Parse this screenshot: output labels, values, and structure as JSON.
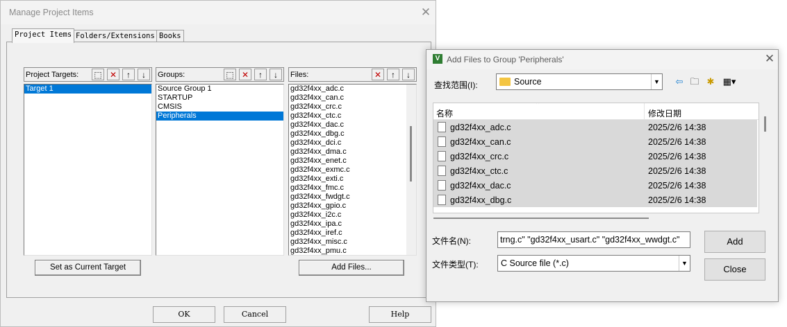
{
  "manage": {
    "title": "Manage Project Items",
    "tabs": [
      "Project Items",
      "Folders/Extensions",
      "Books"
    ],
    "targets_label": "Project Targets:",
    "groups_label": "Groups:",
    "files_label": "Files:",
    "targets": [
      "Target 1"
    ],
    "groups": [
      "Source Group 1",
      "STARTUP",
      "CMSIS",
      "Peripherals"
    ],
    "selected_group": "Peripherals",
    "files": [
      "gd32f4xx_adc.c",
      "gd32f4xx_can.c",
      "gd32f4xx_crc.c",
      "gd32f4xx_ctc.c",
      "gd32f4xx_dac.c",
      "gd32f4xx_dbg.c",
      "gd32f4xx_dci.c",
      "gd32f4xx_dma.c",
      "gd32f4xx_enet.c",
      "gd32f4xx_exmc.c",
      "gd32f4xx_exti.c",
      "gd32f4xx_fmc.c",
      "gd32f4xx_fwdgt.c",
      "gd32f4xx_gpio.c",
      "gd32f4xx_i2c.c",
      "gd32f4xx_ipa.c",
      "gd32f4xx_iref.c",
      "gd32f4xx_misc.c",
      "gd32f4xx_pmu.c"
    ],
    "set_current_label": "Set as Current Target",
    "add_files_label": "Add Files...",
    "ok_label": "OK",
    "cancel_label": "Cancel",
    "help_label": "Help"
  },
  "add_files": {
    "title": "Add Files to Group 'Peripherals'",
    "look_in_label": "查找范围(I):",
    "look_in_value": "Source",
    "col_name": "名称",
    "col_date": "修改日期",
    "rows": [
      {
        "name": "gd32f4xx_adc.c",
        "date": "2025/2/6 14:38"
      },
      {
        "name": "gd32f4xx_can.c",
        "date": "2025/2/6 14:38"
      },
      {
        "name": "gd32f4xx_crc.c",
        "date": "2025/2/6 14:38"
      },
      {
        "name": "gd32f4xx_ctc.c",
        "date": "2025/2/6 14:38"
      },
      {
        "name": "gd32f4xx_dac.c",
        "date": "2025/2/6 14:38"
      },
      {
        "name": "gd32f4xx_dbg.c",
        "date": "2025/2/6 14:38"
      }
    ],
    "filename_label": "文件名(N):",
    "filename_value": "trng.c\" \"gd32f4xx_usart.c\" \"gd32f4xx_wwdgt.c\"",
    "filetype_label": "文件类型(T):",
    "filetype_value": "C Source file (*.c)",
    "add_label": "Add",
    "close_label": "Close"
  }
}
